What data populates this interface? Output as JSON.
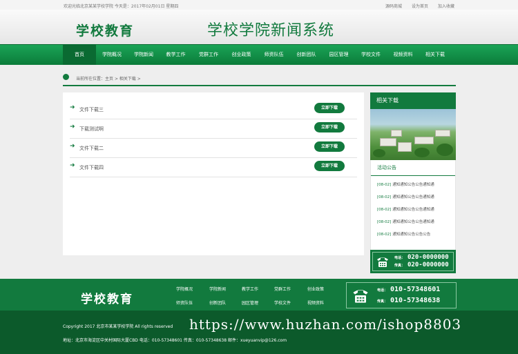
{
  "topbar": {
    "welcome": "欢迎光临北京某某学校学院 今天是：2017年02月01日 星期四",
    "links": [
      "源码商城",
      "设为首页",
      "加入收藏"
    ]
  },
  "header": {
    "logo": "学校教育",
    "site_title": "学校学院新闻系统"
  },
  "nav": {
    "items": [
      "首页",
      "学院概况",
      "学院新闻",
      "教学工作",
      "党群工作",
      "创业政策",
      "师资队伍",
      "创新团队",
      "园区管理",
      "学校文件",
      "视频资料",
      "相关下载"
    ]
  },
  "breadcrumb": {
    "prefix": "当前所在位置：",
    "home": "主页",
    "sep": " > ",
    "current": "相关下载",
    "tail": " >"
  },
  "downloads": {
    "button_label": "立即下载",
    "items": [
      "文件下载三",
      "下载测试啊",
      "文件下载二",
      "文件下载四"
    ]
  },
  "sidebar": {
    "title": "相关下载",
    "notice_title": "活动公告",
    "notices": [
      {
        "date": "[08-02]",
        "text": "通知通知公告公告通知通"
      },
      {
        "date": "[08-02]",
        "text": "通知通知公告公告通知通"
      },
      {
        "date": "[08-02]",
        "text": "通知通知公告公告通知通"
      },
      {
        "date": "[08-02]",
        "text": "通知通知公告公告通知通"
      },
      {
        "date": "[08-02]",
        "text": "通知通知公告公告公告"
      }
    ],
    "contact": {
      "phone_label": "电话：",
      "phone": "020-0000000",
      "fax_label": "传真：",
      "fax": "020-0000000"
    }
  },
  "footer": {
    "logo": "学校教育",
    "links": [
      "学院概况",
      "学院新闻",
      "教学工作",
      "党群工作",
      "创业政策",
      "师资队伍",
      "创新团队",
      "园区管理",
      "学校文件",
      "视频资料"
    ],
    "contact": {
      "phone_label": "电话：",
      "phone": "010-57348601",
      "fax_label": "传真：",
      "fax": "010-57348638"
    },
    "copyright": "Copyright 2017 北京市某某学校学院 All rights reserved",
    "address": "地址：北京市海淀区中关村国际大厦CBD 电话：010-57348601 传真：010-57348638 邮件：xueyuanvip@126.com",
    "watermark": "https://www.huzhan.com/ishop8803"
  },
  "colors": {
    "brand_green": "#127a3e",
    "dark_green": "#0c5a2b"
  }
}
